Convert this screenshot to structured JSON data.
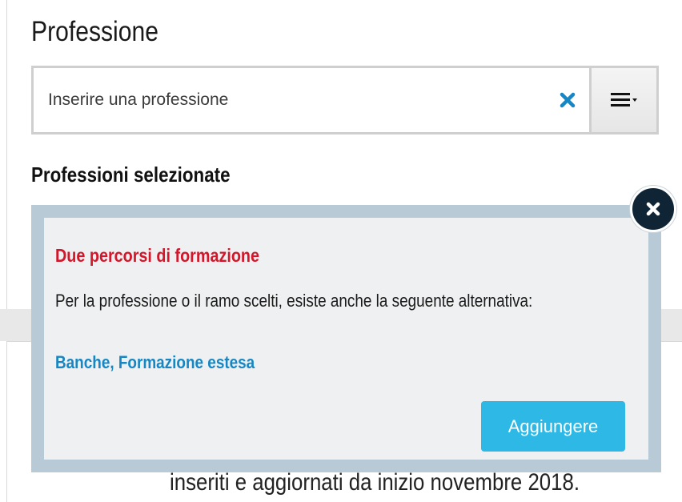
{
  "header": {
    "title": "Professione"
  },
  "search": {
    "placeholder": "Inserire una professione",
    "clear_icon": "close-x-icon",
    "menu_icon": "hamburger-dropdown-icon",
    "clear_color": "#1687c4"
  },
  "selected": {
    "heading": "Professioni selezionate"
  },
  "background": {
    "partial_text": "inseriti e aggiornati da inizio novembre 2018."
  },
  "popup": {
    "title": "Due percorsi di formazione",
    "body": "Per la professione o il ramo scelti, esiste anche la seguente alternativa:",
    "link": "Banche, Formazione estesa",
    "add_label": "Aggiungere",
    "close_icon": "close-circle-icon",
    "colors": {
      "title": "#d4162a",
      "link": "#1687c4",
      "button": "#2db8e6",
      "frame": "#b7cad6",
      "close_bg": "#0f2535"
    }
  }
}
